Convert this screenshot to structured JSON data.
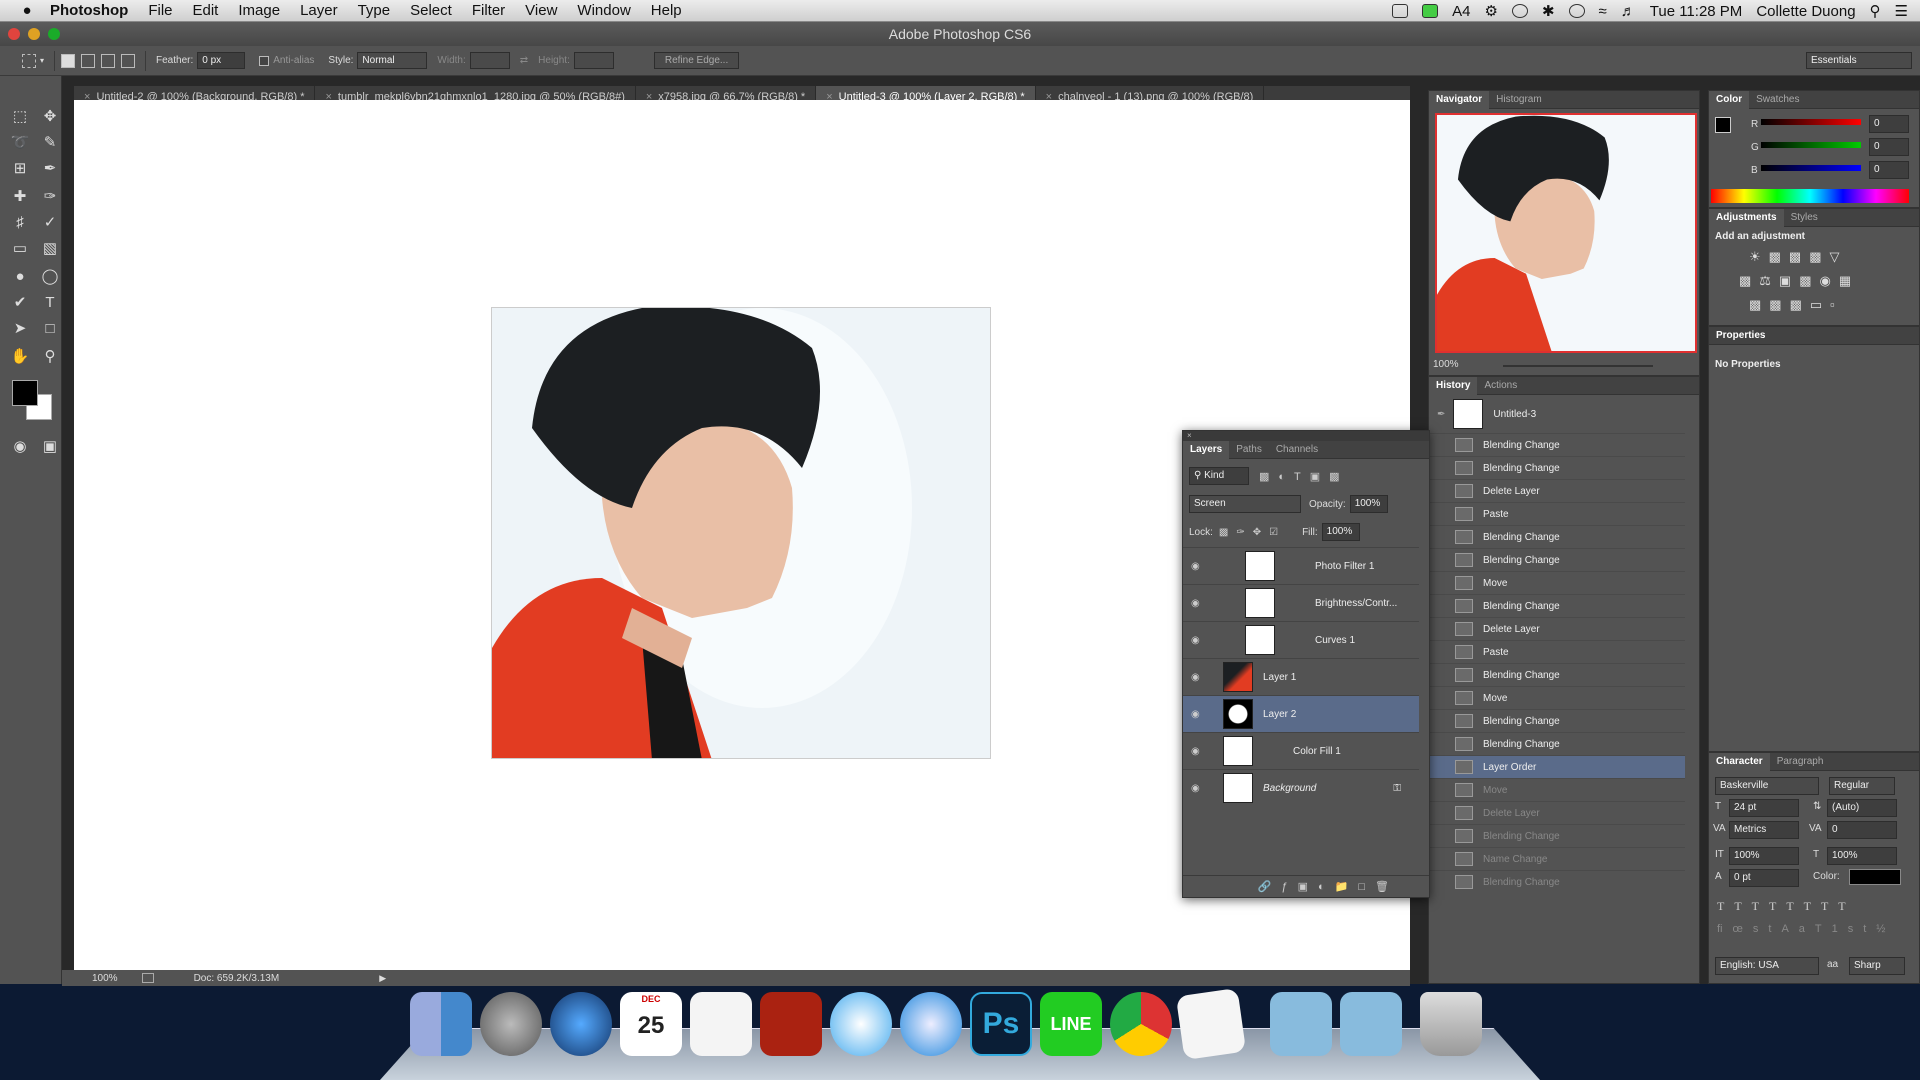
{
  "menubar": {
    "app": "Photoshop",
    "items": [
      "File",
      "Edit",
      "Image",
      "Layer",
      "Type",
      "Select",
      "Filter",
      "View",
      "Window",
      "Help"
    ],
    "right": {
      "badge": "4",
      "clock": "Tue 11:28 PM",
      "user": "Collette Duong"
    }
  },
  "window": {
    "title": "Adobe Photoshop CS6"
  },
  "options": {
    "feather_label": "Feather:",
    "feather_value": "0 px",
    "antialias": "Anti-alias",
    "style_label": "Style:",
    "style_value": "Normal",
    "width_label": "Width:",
    "height_label": "Height:",
    "refine": "Refine Edge...",
    "workspace": "Essentials"
  },
  "tabs": [
    {
      "label": "Untitled-2 @ 100% (Background, RGB/8) *"
    },
    {
      "label": "tumblr_mekpl6vbn21qhmxnlo1_1280.jpg @ 50% (RGB/8#)"
    },
    {
      "label": "x7958.jpg @ 66.7% (RGB/8) *"
    },
    {
      "label": "Untitled-3 @ 100% (Layer 2, RGB/8) *"
    },
    {
      "label": "chalnyeol - 1 (13).png @ 100% (RGB/8)"
    }
  ],
  "status": {
    "zoom": "100%",
    "doc": "Doc: 659.2K/3.13M"
  },
  "navigator": {
    "tabs": [
      "Navigator",
      "Histogram"
    ],
    "zoom": "100%"
  },
  "color": {
    "tabs": [
      "Color",
      "Swatches"
    ],
    "channels": [
      {
        "label": "R",
        "value": "0"
      },
      {
        "label": "G",
        "value": "0"
      },
      {
        "label": "B",
        "value": "0"
      }
    ]
  },
  "adjustments": {
    "tabs": [
      "Adjustments",
      "Styles"
    ],
    "label": "Add an adjustment"
  },
  "properties": {
    "title": "Properties",
    "text": "No Properties"
  },
  "history": {
    "tabs": [
      "History",
      "Actions"
    ],
    "snapshot": "Untitled-3",
    "items": [
      {
        "label": "Blending Change",
        "state": "normal"
      },
      {
        "label": "Blending Change",
        "state": "normal"
      },
      {
        "label": "Delete Layer",
        "state": "normal"
      },
      {
        "label": "Paste",
        "state": "normal"
      },
      {
        "label": "Blending Change",
        "state": "normal"
      },
      {
        "label": "Blending Change",
        "state": "normal"
      },
      {
        "label": "Move",
        "state": "normal"
      },
      {
        "label": "Blending Change",
        "state": "normal"
      },
      {
        "label": "Delete Layer",
        "state": "normal"
      },
      {
        "label": "Paste",
        "state": "normal"
      },
      {
        "label": "Blending Change",
        "state": "normal"
      },
      {
        "label": "Move",
        "state": "normal"
      },
      {
        "label": "Blending Change",
        "state": "normal"
      },
      {
        "label": "Blending Change",
        "state": "normal"
      },
      {
        "label": "Layer Order",
        "state": "selected"
      },
      {
        "label": "Move",
        "state": "dim"
      },
      {
        "label": "Delete Layer",
        "state": "dim"
      },
      {
        "label": "Blending Change",
        "state": "dim"
      },
      {
        "label": "Name Change",
        "state": "dim"
      },
      {
        "label": "Blending Change",
        "state": "dim"
      }
    ]
  },
  "layers": {
    "tabs": [
      "Layers",
      "Paths",
      "Channels"
    ],
    "kind": "Kind",
    "blend_mode": "Screen",
    "opacity_label": "Opacity:",
    "opacity": "100%",
    "lock_label": "Lock:",
    "fill_label": "Fill:",
    "fill": "100%",
    "items": [
      {
        "name": "Photo Filter 1",
        "selected": false
      },
      {
        "name": "Brightness/Contr...",
        "selected": false
      },
      {
        "name": "Curves 1",
        "selected": false
      },
      {
        "name": "Layer 1",
        "selected": false
      },
      {
        "name": "Layer 2",
        "selected": true
      },
      {
        "name": "Color Fill 1",
        "selected": false
      },
      {
        "name": "Background",
        "selected": false
      }
    ]
  },
  "character": {
    "tabs": [
      "Character",
      "Paragraph"
    ],
    "font": "Baskerville",
    "style": "Regular",
    "size": "24 pt",
    "leading": "(Auto)",
    "kerning": "Metrics",
    "tracking": "0",
    "vscale": "100%",
    "hscale": "100%",
    "baseline": "0 pt",
    "color_label": "Color:",
    "language": "English: USA",
    "aa": "Sharp"
  },
  "dock": [
    "Finder",
    "Launchpad",
    "App Store",
    "Calendar",
    "Reminders",
    "Photo Booth",
    "iTunes",
    "Safari",
    "Photoshop",
    "LINE",
    "Chrome",
    "TextEdit",
    "Downloads",
    "Applications",
    "Trash"
  ],
  "dock_badge": {
    "month": "DEC",
    "day": "25"
  }
}
